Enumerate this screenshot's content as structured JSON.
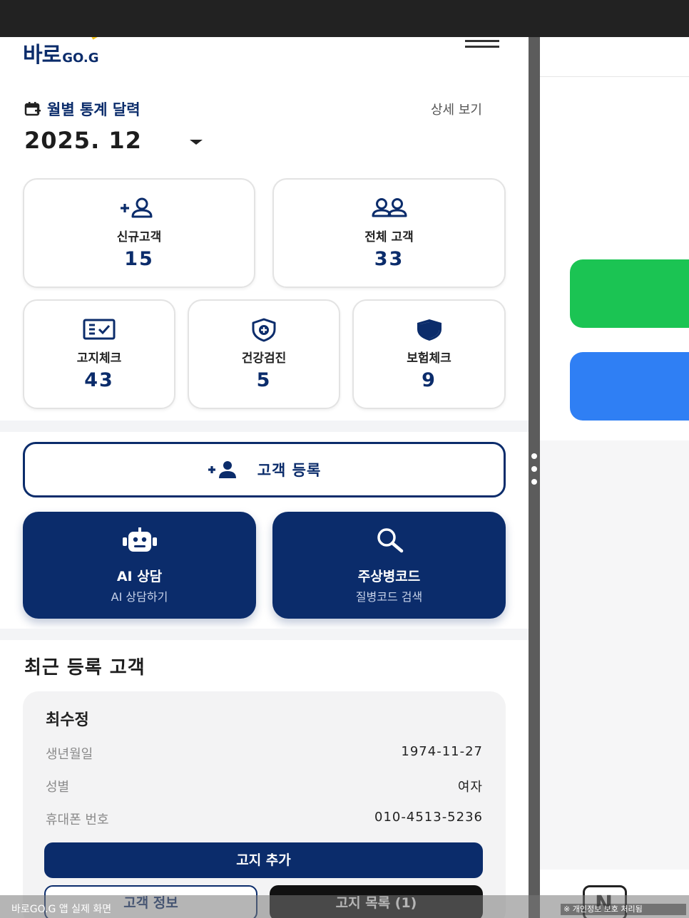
{
  "app": {
    "logo_ko": "바로",
    "logo_en": "GO.G"
  },
  "calendar": {
    "title": "월별 통계 달력",
    "detail_link": "상세 보기",
    "month": "2025. 12"
  },
  "stats": [
    {
      "label": "신규고객",
      "value": "15",
      "icon": "add-user-icon"
    },
    {
      "label": "전체 고객",
      "value": "33",
      "icon": "users-icon"
    },
    {
      "label": "고지체크",
      "value": "43",
      "icon": "checklist-icon"
    },
    {
      "label": "건강검진",
      "value": "5",
      "icon": "shield-plus-icon"
    },
    {
      "label": "보험체크",
      "value": "9",
      "icon": "shield-icon"
    }
  ],
  "register_button": "고객 등록",
  "actions": [
    {
      "title": "AI 상담",
      "subtitle": "AI 상담하기",
      "icon": "robot-icon"
    },
    {
      "title": "주상병코드",
      "subtitle": "질병코드 검색",
      "icon": "search-icon"
    }
  ],
  "recent": {
    "title": "최근 등록 고객",
    "customer": {
      "name": "최수정",
      "fields": [
        {
          "label": "생년월일",
          "value": "1974-11-27"
        },
        {
          "label": "성별",
          "value": "여자"
        },
        {
          "label": "휴대폰 번호",
          "value": "010-4513-5236"
        }
      ],
      "add_notice": "고지 추가",
      "info_button": "고객 정보",
      "list_button": "고지 목록 (1)"
    }
  },
  "captions": {
    "left": "바로GO.G 앱 실제 화면",
    "right": "※ 개인정보 보호 처리됨"
  },
  "colors": {
    "primary": "#0b2c6b",
    "green": "#1bc453",
    "blue": "#2f7ff4"
  }
}
